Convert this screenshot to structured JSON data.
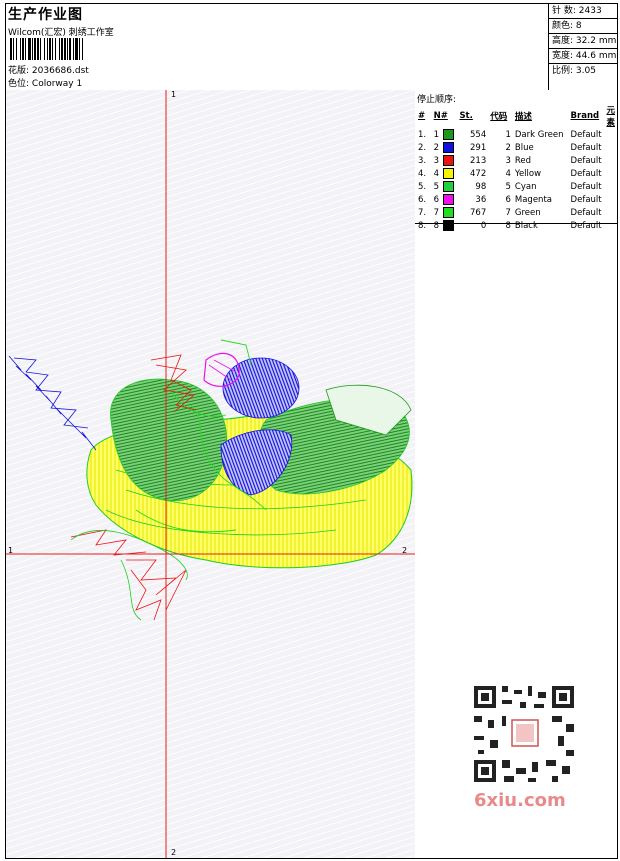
{
  "header": {
    "title": "生产作业图",
    "company": "Wilcom(汇宏) 刺绣工作室",
    "design_label": "花版:",
    "design_file": "2036686.dst",
    "colorway_label": "色位:",
    "colorway": "Colorway 1"
  },
  "stats": [
    {
      "label": "针 数:",
      "value": "2433"
    },
    {
      "label": "颜色:",
      "value": "8"
    },
    {
      "label": "高度:",
      "value": "32.2 mm"
    },
    {
      "label": "宽度:",
      "value": "44.6 mm"
    },
    {
      "label": "比例:",
      "value": "3.05"
    }
  ],
  "legend": {
    "title": "停止顺序:",
    "columns": [
      "#",
      "N#",
      "St.",
      "代码",
      "描述",
      "Brand",
      "元素"
    ],
    "rows": [
      {
        "idx": "1.",
        "n": "1",
        "color": "#1a9a1a",
        "st": "554",
        "code": "1",
        "desc": "Dark Green",
        "brand": "Default"
      },
      {
        "idx": "2.",
        "n": "2",
        "color": "#1010e0",
        "st": "291",
        "code": "2",
        "desc": "Blue",
        "brand": "Default"
      },
      {
        "idx": "3.",
        "n": "3",
        "color": "#ee1111",
        "st": "213",
        "code": "3",
        "desc": "Red",
        "brand": "Default"
      },
      {
        "idx": "4.",
        "n": "4",
        "color": "#f5f500",
        "st": "472",
        "code": "4",
        "desc": "Yellow",
        "brand": "Default"
      },
      {
        "idx": "5.",
        "n": "5",
        "color": "#20d040",
        "st": "98",
        "code": "5",
        "desc": "Cyan",
        "brand": "Default"
      },
      {
        "idx": "6.",
        "n": "6",
        "color": "#ee10ee",
        "st": "36",
        "code": "6",
        "desc": "Magenta",
        "brand": "Default"
      },
      {
        "idx": "7.",
        "n": "7",
        "color": "#22dd22",
        "st": "767",
        "code": "7",
        "desc": "Green",
        "brand": "Default"
      },
      {
        "idx": "8.",
        "n": "8",
        "color": "#000000",
        "st": "0",
        "code": "8",
        "desc": "Black",
        "brand": "Default"
      }
    ]
  },
  "axes": {
    "v_top": "1",
    "v_bottom": "2",
    "h_left": "1",
    "h_right": "2"
  },
  "watermark": "6xiu.com"
}
